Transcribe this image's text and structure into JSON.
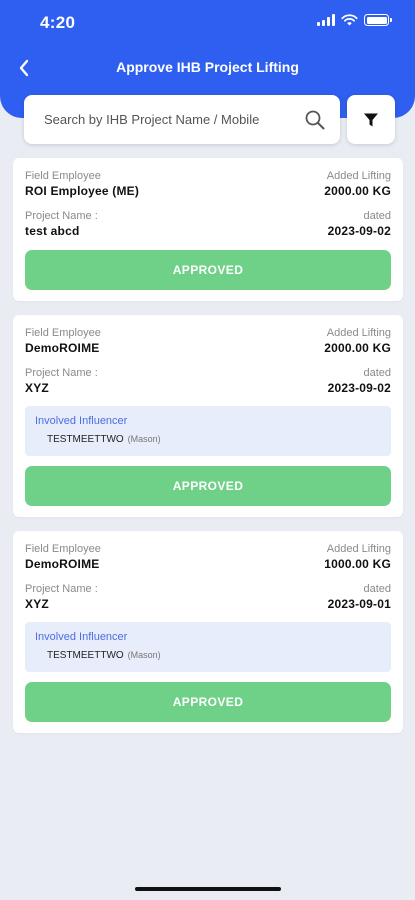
{
  "status_bar": {
    "time": "4:20"
  },
  "header": {
    "title": "Approve IHB Project Lifting"
  },
  "search": {
    "placeholder": "Search by IHB Project Name / Mobile"
  },
  "colors": {
    "primary": "#2f5ff0",
    "approved": "#6fd188",
    "influencer_bg": "#e8edfb",
    "influencer_title": "#4a6de5"
  },
  "icons": {
    "back": "chevron-left-icon",
    "search": "search-icon",
    "filter": "filter-icon"
  },
  "labels": {
    "field_employee": "Field Employee",
    "added_lifting": "Added Lifting",
    "project_name": "Project Name :",
    "dated": "dated",
    "involved_influencer": "Involved Influencer"
  },
  "cards": [
    {
      "employee": "ROI Employee (ME)",
      "lifting": "2000.00 KG",
      "project": "test abcd",
      "date": "2023-09-02",
      "status": "APPROVED"
    },
    {
      "employee": "DemoROIME",
      "lifting": "2000.00 KG",
      "project": "XYZ",
      "date": "2023-09-02",
      "influencer": {
        "name": "TESTMEETTWO",
        "role": "(Mason)"
      },
      "status": "APPROVED"
    },
    {
      "employee": "DemoROIME",
      "lifting": "1000.00 KG",
      "project": "XYZ",
      "date": "2023-09-01",
      "influencer": {
        "name": "TESTMEETTWO",
        "role": "(Mason)"
      },
      "status": "APPROVED"
    }
  ]
}
